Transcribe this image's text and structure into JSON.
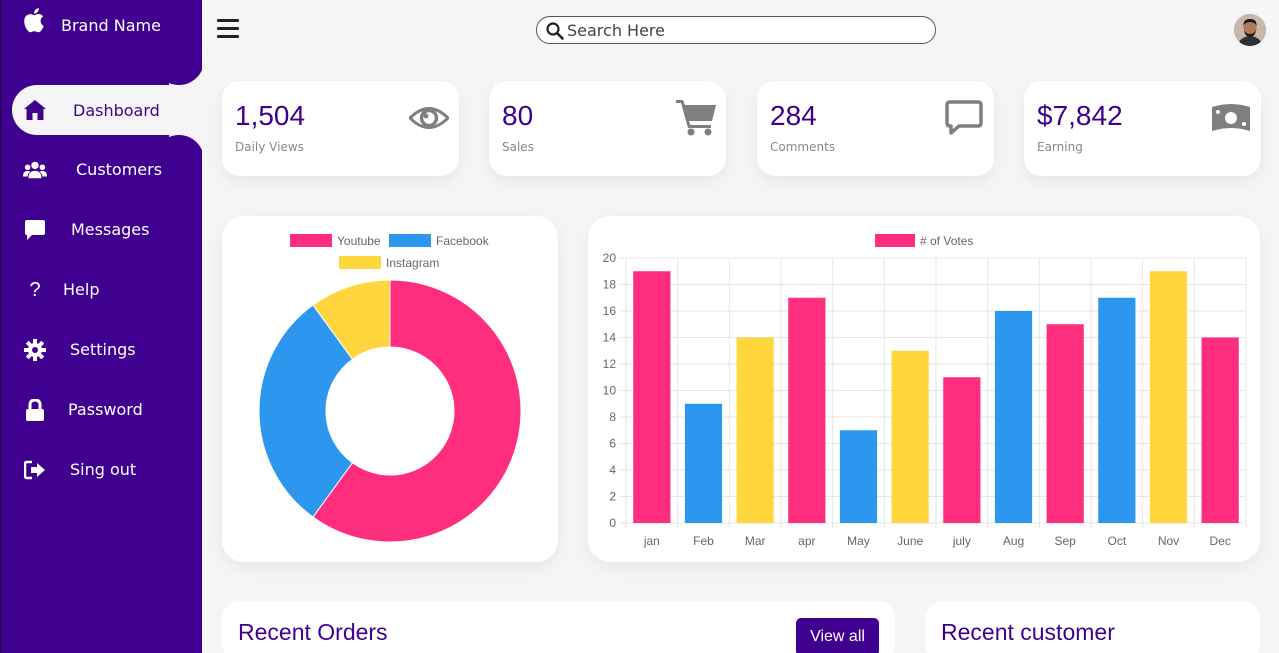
{
  "brand": {
    "name": "Brand Name",
    "logo_icon": "apple-logo-icon"
  },
  "nav": [
    {
      "label": "Dashboard",
      "icon": "home-icon"
    },
    {
      "label": "Customers",
      "icon": "users-icon"
    },
    {
      "label": "Messages",
      "icon": "chat-icon"
    },
    {
      "label": "Help",
      "icon": "question-icon"
    },
    {
      "label": "Settings",
      "icon": "gear-icon"
    },
    {
      "label": "Password",
      "icon": "lock-icon"
    },
    {
      "label": "Sing out",
      "icon": "sign-out-icon"
    }
  ],
  "search": {
    "placeholder": "Search Here"
  },
  "cards": [
    {
      "value": "1,504",
      "caption": "Daily Views",
      "icon": "eye-icon"
    },
    {
      "value": "80",
      "caption": "Sales",
      "icon": "cart-icon"
    },
    {
      "value": "284",
      "caption": "Comments",
      "icon": "comment-icon"
    },
    {
      "value": "$7,842",
      "caption": "Earning",
      "icon": "money-icon"
    }
  ],
  "colors": {
    "primary": "#3f0090",
    "pink": "#ff2d7d",
    "blue": "#2d96ee",
    "yellow": "#ffd63d"
  },
  "chart_data": [
    {
      "type": "pie",
      "labels": [
        "Youtube",
        "Facebook",
        "Instagram"
      ],
      "values": [
        60,
        30,
        10
      ],
      "colors": [
        "#ff2d7d",
        "#2d96ee",
        "#ffd63d"
      ],
      "legend": "top"
    },
    {
      "type": "bar",
      "categories": [
        "jan",
        "Feb",
        "Mar",
        "apr",
        "May",
        "June",
        "july",
        "Aug",
        "Sep",
        "Oct",
        "Nov",
        "Dec"
      ],
      "series": [
        {
          "name": "# of Votes",
          "values": [
            19,
            9,
            14,
            17,
            7,
            13,
            11,
            16,
            15,
            17,
            19,
            14
          ]
        }
      ],
      "bar_colors": [
        "#ff2d7d",
        "#2d96ee",
        "#ffd63d",
        "#ff2d7d",
        "#2d96ee",
        "#ffd63d",
        "#ff2d7d",
        "#2d96ee",
        "#ff2d7d",
        "#2d96ee",
        "#ffd63d",
        "#ff2d7d"
      ],
      "yticks": [
        "0",
        "2",
        "4",
        "6",
        "8",
        "10",
        "12",
        "14",
        "16",
        "18",
        "20"
      ],
      "ylim": [
        0,
        20
      ],
      "grid": true,
      "legend": "top"
    }
  ],
  "recent_orders": {
    "title": "Recent Orders",
    "button": "View all"
  },
  "recent_customer": {
    "title": "Recent customer"
  }
}
